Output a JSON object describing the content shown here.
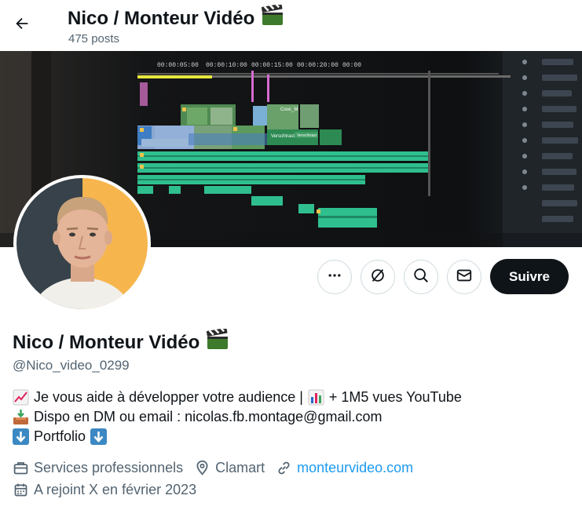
{
  "header": {
    "title": "Nico / Monteur Vidéo",
    "posts_count": "475 posts"
  },
  "banner": {
    "timecodes": [
      "00:00:05:00",
      "00:00:10:00",
      "00:00:15:00",
      "00:00:20:00",
      "00:00"
    ],
    "clip_labels": [
      "Cooc_M",
      "Verschtrast",
      "Verschtrast"
    ]
  },
  "actions": {
    "follow_label": "Suivre"
  },
  "profile": {
    "name": "Nico / Monteur Vidéo",
    "handle": "@Nico_video_0299",
    "bio": {
      "line1_a": "Je vous aide à développer votre audience |",
      "line1_b": "+ 1M5 vues YouTube",
      "line2": "Dispo en DM ou email : nicolas.fb.montage@gmail.com",
      "line3": "Portfolio"
    },
    "category": "Services professionnels",
    "location": "Clamart",
    "website": "monteurvideo.com",
    "joined": "A rejoint X en février 2023"
  },
  "icons": {
    "back": "arrow-left-icon",
    "clapper": "clapper-board-icon",
    "more": "more-dots-icon",
    "subscribe": "subscribe-icon",
    "search": "search-icon",
    "message": "envelope-icon",
    "briefcase": "briefcase-icon",
    "pin": "location-pin-icon",
    "link": "link-icon",
    "calendar": "calendar-icon"
  }
}
